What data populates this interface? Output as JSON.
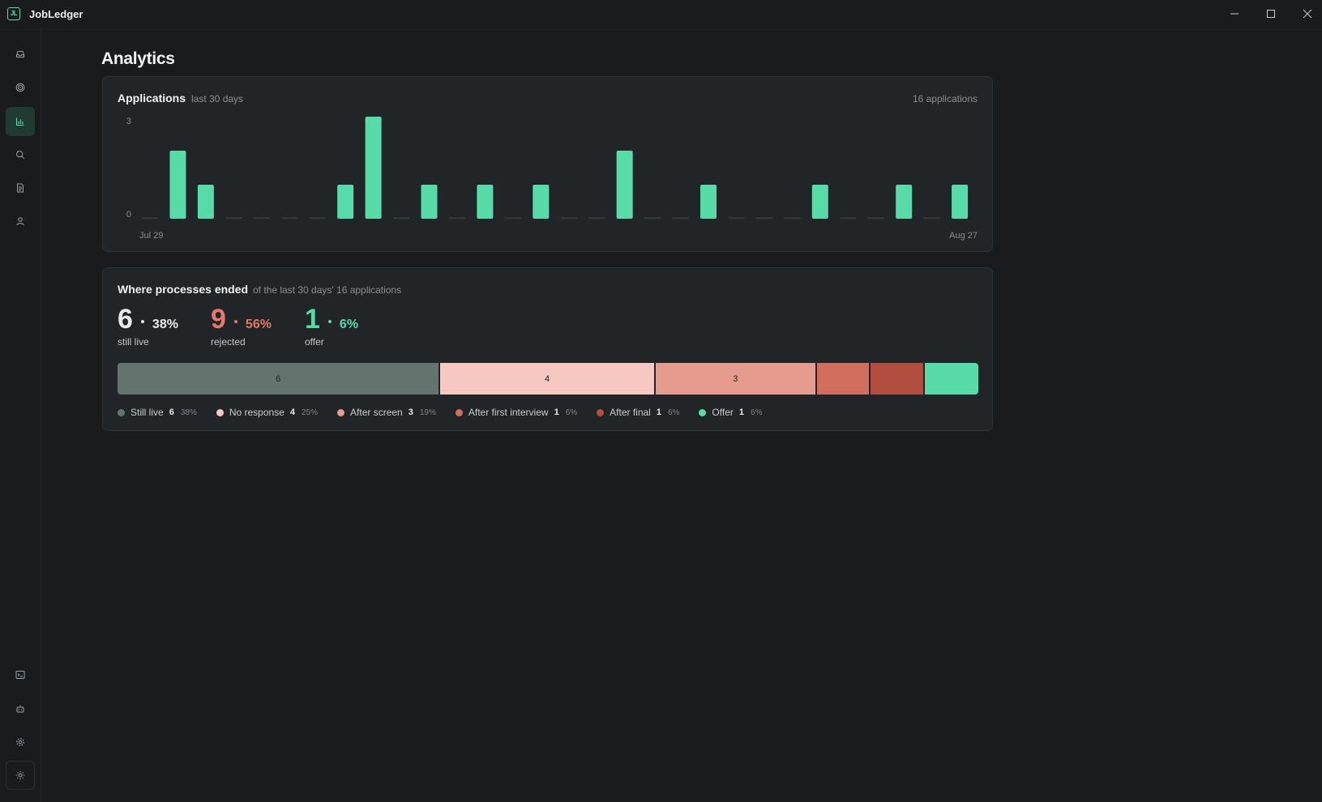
{
  "app": {
    "logo_text": "JL",
    "name": "JobLedger",
    "accent": "#57dba8"
  },
  "window_controls": [
    "minimize-icon",
    "maximize-icon",
    "close-icon"
  ],
  "sidebar": {
    "items": [
      {
        "icon": "inbox-icon",
        "active": false
      },
      {
        "icon": "target-icon",
        "active": false
      },
      {
        "icon": "bar-chart-icon",
        "active": true
      },
      {
        "icon": "search-icon",
        "active": false
      },
      {
        "icon": "document-icon",
        "active": false
      },
      {
        "icon": "user-icon",
        "active": false
      }
    ],
    "bottom_items": [
      {
        "icon": "terminal-icon"
      },
      {
        "icon": "robot-icon"
      },
      {
        "icon": "gear-icon"
      },
      {
        "icon": "sun-icon"
      }
    ]
  },
  "page": {
    "title": "Analytics"
  },
  "applications_card": {
    "title": "Applications",
    "subtitle": "last 30 days",
    "total": "16 applications"
  },
  "chart_data": {
    "type": "bar",
    "title": "Applications",
    "subtitle": "last 30 days",
    "x_start_label": "Jul 29",
    "x_end_label": "Aug 27",
    "y_ticks": [
      "3",
      "0"
    ],
    "ylim": [
      0,
      3
    ],
    "bar_color": "#57dba8",
    "empty_color": "#3a3f42",
    "values": [
      0,
      2,
      1,
      0,
      0,
      0,
      0,
      1,
      3,
      0,
      1,
      0,
      1,
      0,
      1,
      0,
      0,
      2,
      0,
      0,
      1,
      0,
      0,
      0,
      1,
      0,
      0,
      1,
      0,
      1
    ]
  },
  "ended_card": {
    "title": "Where processes ended",
    "subtitle": "of the last 30 days' 16 applications",
    "stats": [
      {
        "value": "6",
        "pct": "38%",
        "label": "still live",
        "color": "#e8eaeb",
        "pct_color": "#e8eaeb"
      },
      {
        "value": "9",
        "pct": "56%",
        "label": "rejected",
        "color": "#e5786a",
        "pct_color": "#e5786a"
      },
      {
        "value": "1",
        "pct": "6%",
        "label": "offer",
        "color": "#57dba8",
        "pct_color": "#57dba8"
      }
    ],
    "segments": [
      {
        "name": "Still live",
        "count": 6,
        "bar_label": "6",
        "pct": "38%",
        "color": "#64736e"
      },
      {
        "name": "No response",
        "count": 4,
        "bar_label": "4",
        "pct": "25%",
        "color": "#f6c8c1"
      },
      {
        "name": "After screen",
        "count": 3,
        "bar_label": "3",
        "pct": "19%",
        "color": "#e59c8f"
      },
      {
        "name": "After first interview",
        "count": 1,
        "bar_label": "",
        "pct": "6%",
        "color": "#d26e5e"
      },
      {
        "name": "After final",
        "count": 1,
        "bar_label": "",
        "pct": "6%",
        "color": "#b24e3f"
      },
      {
        "name": "Offer",
        "count": 1,
        "bar_label": "",
        "pct": "6%",
        "color": "#57dba8"
      }
    ]
  }
}
